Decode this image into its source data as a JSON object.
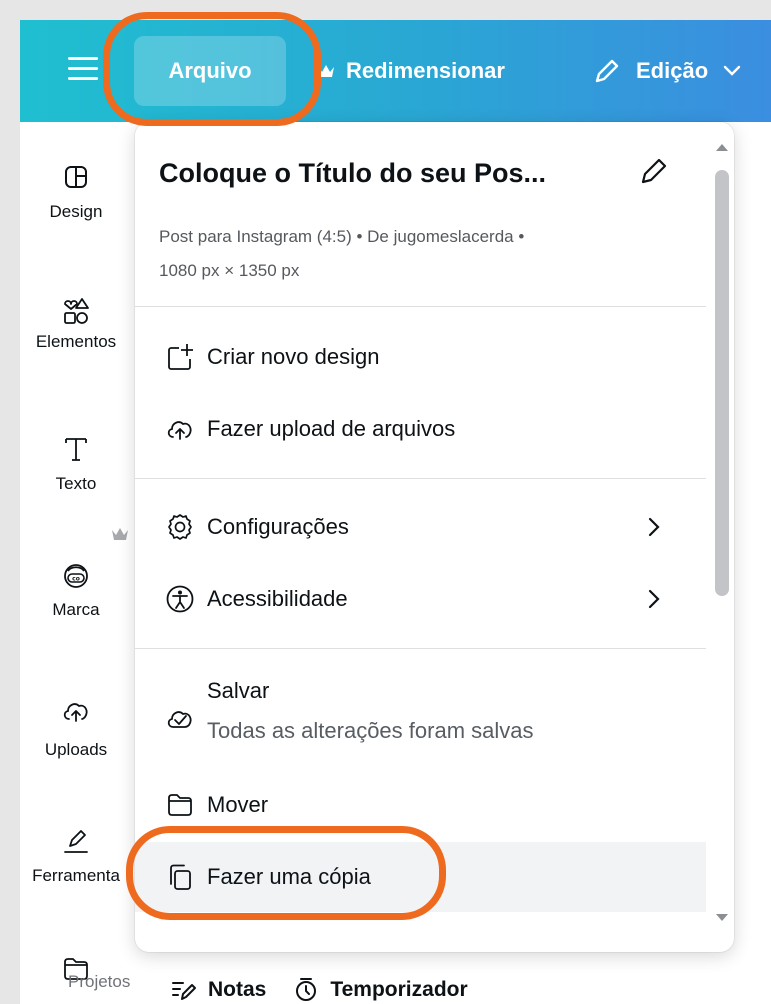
{
  "topbar": {
    "file_label": "Arquivo",
    "resize_label": "Redimensionar",
    "edit_label": "Edição"
  },
  "sidebar": {
    "items": [
      {
        "label": "Design",
        "icon": "layout-icon"
      },
      {
        "label": "Elementos",
        "icon": "shapes-icon"
      },
      {
        "label": "Texto",
        "icon": "text-icon"
      },
      {
        "label": "Marca",
        "icon": "brand-icon"
      },
      {
        "label": "Uploads",
        "icon": "upload-cloud-icon"
      },
      {
        "label": "Ferramenta",
        "icon": "draw-tool-icon"
      },
      {
        "label": "Projetos",
        "icon": "folder-icon"
      }
    ]
  },
  "menu": {
    "title": "Coloque o Título do seu Pos...",
    "subtitle_line1": "Post para Instagram (4:5) • De jugomeslacerda •",
    "subtitle_line2": "1080 px × 1350 px",
    "items": {
      "create": "Criar novo design",
      "upload": "Fazer upload de arquivos",
      "settings": "Configurações",
      "accessibility": "Acessibilidade",
      "save_title": "Salvar",
      "save_status": "Todas as alterações foram salvas",
      "move": "Mover",
      "copy": "Fazer uma cópia"
    }
  },
  "bottombar": {
    "notes": "Notas",
    "timer": "Temporizador"
  },
  "colors": {
    "topbar_start": "#1fbfd0",
    "topbar_end": "#3b8ee0",
    "annotation": "#ee6a1f"
  }
}
